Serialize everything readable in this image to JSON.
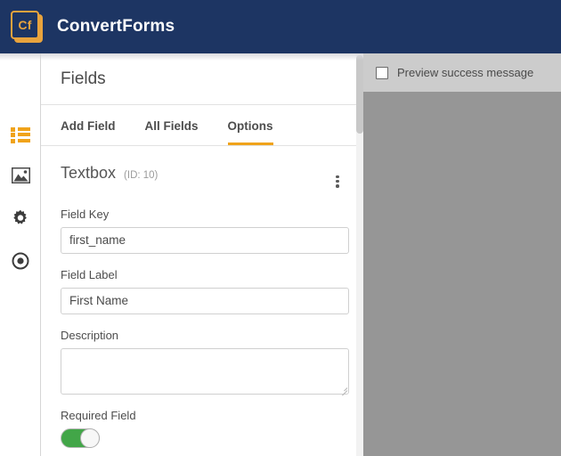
{
  "topbar": {
    "logo_text": "Cf",
    "logo_icon": "convertforms-logo-icon",
    "brand": "ConvertForms",
    "bg_color": "#1d3563",
    "accent_color": "#e8a33d"
  },
  "sidebar": {
    "items": [
      {
        "icon": "list-icon",
        "name": "fields",
        "active": true
      },
      {
        "icon": "image-icon",
        "name": "media",
        "active": false
      },
      {
        "icon": "gear-icon",
        "name": "settings",
        "active": false
      },
      {
        "icon": "target-icon",
        "name": "publishing",
        "active": false
      }
    ]
  },
  "main": {
    "title": "Fields",
    "tabs": [
      {
        "label": "Add Field",
        "active": false
      },
      {
        "label": "All Fields",
        "active": false
      },
      {
        "label": "Options",
        "active": true
      }
    ],
    "active_tab_color": "#f0a31a",
    "field": {
      "type": "Textbox",
      "id_text": "(ID: 10)",
      "menu_icon": "kebab-menu-icon",
      "field_key_label": "Field Key",
      "field_key_value": "first_name",
      "field_key_placeholder": "",
      "field_label_label": "Field Label",
      "field_label_value": "First Name",
      "field_label_placeholder": "",
      "description_label": "Description",
      "description_value": "",
      "description_placeholder": "",
      "required_label": "Required Field",
      "required_on": true,
      "toggle_on_color": "#42a648"
    }
  },
  "preview": {
    "checkbox_label": "Preview success message",
    "checkbox_checked": false,
    "toolbar_color": "#cccccc",
    "body_color": "#969696"
  }
}
